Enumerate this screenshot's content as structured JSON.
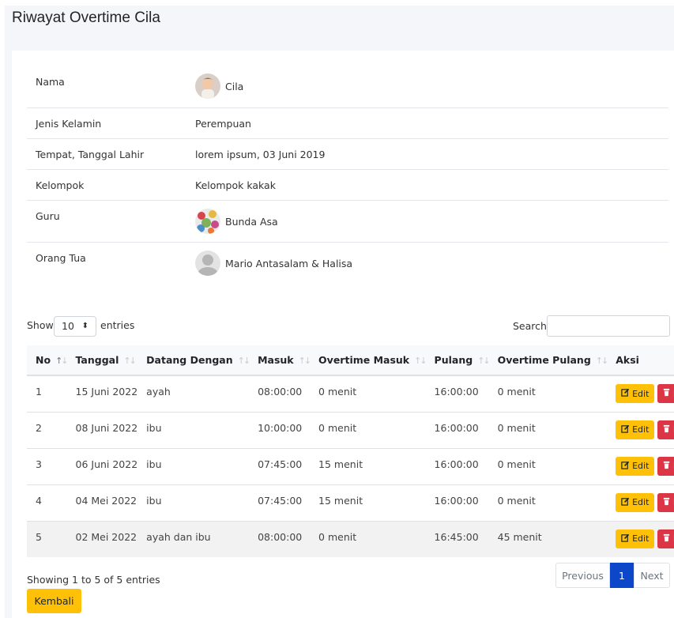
{
  "page": {
    "title": "Riwayat Overtime Cila"
  },
  "profile": {
    "rows": [
      {
        "label": "Nama",
        "value": "Cila",
        "avatar": "child-photo"
      },
      {
        "label": "Jenis Kelamin",
        "value": "Perempuan"
      },
      {
        "label": "Tempat, Tanggal Lahir",
        "value": "lorem ipsum, 03 Juni 2019"
      },
      {
        "label": "Kelompok",
        "value": "Kelompok kakak"
      },
      {
        "label": "Guru",
        "value": "Bunda Asa",
        "avatar": "floral-photo"
      },
      {
        "label": "Orang Tua",
        "value": "Mario Antasalam & Halisa",
        "avatar": "default-user"
      }
    ]
  },
  "datatable": {
    "show_label": "Show",
    "length_value": "10",
    "entries_label": "entries",
    "search_label": "Search:",
    "search_value": "",
    "columns": [
      "No",
      "Tanggal",
      "Datang Dengan",
      "Masuk",
      "Overtime Masuk",
      "Pulang",
      "Overtime Pulang",
      "Aksi"
    ],
    "rows": [
      {
        "no": "1",
        "tanggal": "15 Juni 2022",
        "datang": "ayah",
        "masuk": "08:00:00",
        "ot_masuk": "0 menit",
        "pulang": "16:00:00",
        "ot_pulang": "0 menit"
      },
      {
        "no": "2",
        "tanggal": "08 Juni 2022",
        "datang": "ibu",
        "masuk": "10:00:00",
        "ot_masuk": "0 menit",
        "pulang": "16:00:00",
        "ot_pulang": "0 menit"
      },
      {
        "no": "3",
        "tanggal": "06 Juni 2022",
        "datang": "ibu",
        "masuk": "07:45:00",
        "ot_masuk": "15 menit",
        "pulang": "16:00:00",
        "ot_pulang": "0 menit"
      },
      {
        "no": "4",
        "tanggal": "04 Mei 2022",
        "datang": "ibu",
        "masuk": "07:45:00",
        "ot_masuk": "15 menit",
        "pulang": "16:00:00",
        "ot_pulang": "0 menit"
      },
      {
        "no": "5",
        "tanggal": "02 Mei 2022",
        "datang": "ayah dan ibu",
        "masuk": "08:00:00",
        "ot_masuk": "0 menit",
        "pulang": "16:45:00",
        "ot_pulang": "45 menit"
      }
    ],
    "edit_label": "Edit",
    "delete_label": "Hapus",
    "info": "Showing 1 to 5 of 5 entries",
    "pagination": {
      "previous": "Previous",
      "current": "1",
      "next": "Next"
    }
  },
  "actions": {
    "back_label": "Kembali"
  },
  "colors": {
    "edit": "#ffc107",
    "delete": "#dc3545",
    "page_active": "#0d47c9"
  }
}
